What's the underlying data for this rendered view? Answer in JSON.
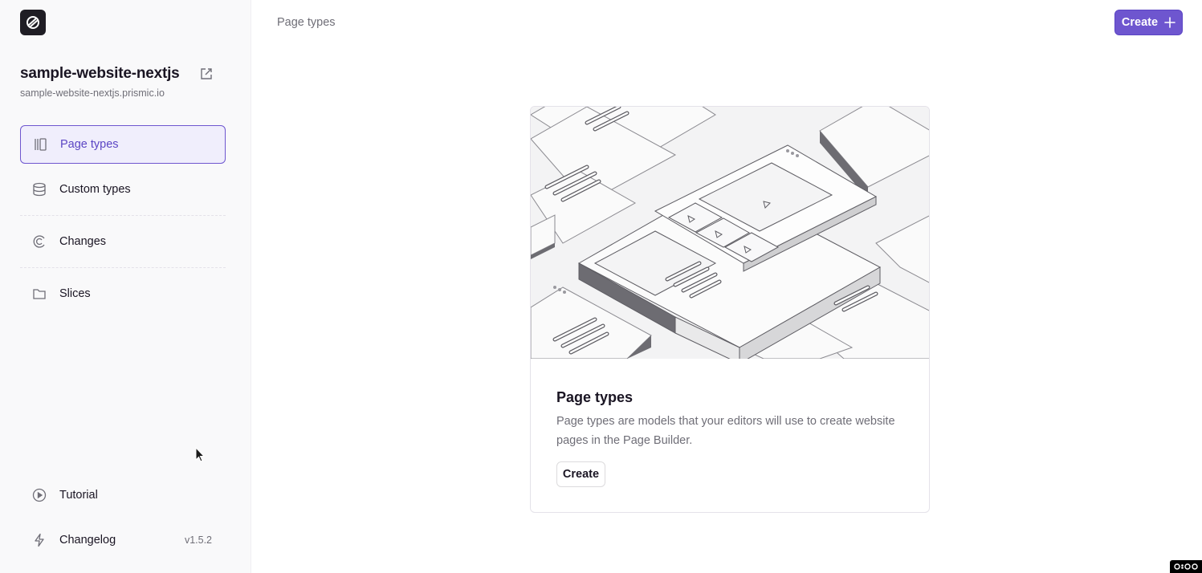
{
  "sidebar": {
    "logo_icon": "prismic-logo-icon",
    "repo": {
      "name": "sample-website-nextjs",
      "url": "sample-website-nextjs.prismic.io",
      "external_link_icon": "external-link-icon"
    },
    "nav": [
      {
        "label": "Page types",
        "icon": "page-types-icon",
        "active": true
      },
      {
        "label": "Custom types",
        "icon": "database-icon",
        "active": false
      },
      {
        "label": "Changes",
        "icon": "changes-icon",
        "active": false
      },
      {
        "label": "Slices",
        "icon": "folder-icon",
        "active": false
      }
    ],
    "bottom_nav": [
      {
        "label": "Tutorial",
        "icon": "play-circle-icon"
      },
      {
        "label": "Changelog",
        "icon": "lightning-icon",
        "badge": "v1.5.2"
      }
    ]
  },
  "header": {
    "breadcrumb": "Page types",
    "create_label": "Create"
  },
  "empty_state": {
    "title": "Page types",
    "description": "Page types are models that your editors will use to create website pages in the Page Builder.",
    "button_label": "Create"
  },
  "colors": {
    "accent": "#6e56cf",
    "active_bg": "#f0eefc",
    "sidebar_bg": "#f9f9fa"
  }
}
